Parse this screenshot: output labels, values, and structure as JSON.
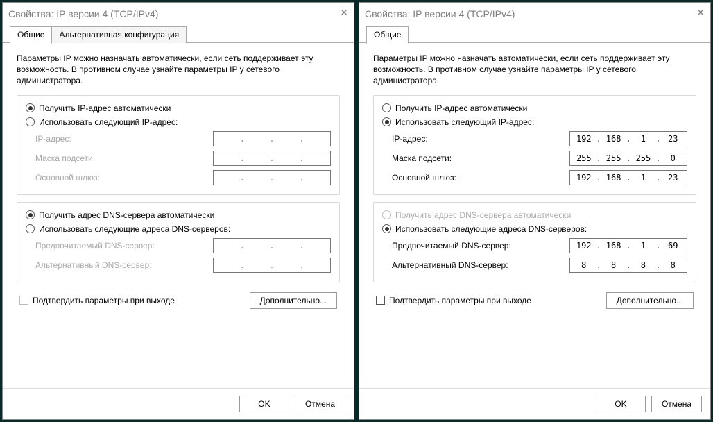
{
  "left": {
    "title": "Свойства: IP версии 4 (TCP/IPv4)",
    "tabs": {
      "general": "Общие",
      "alt": "Альтернативная конфигурация"
    },
    "intro": "Параметры IP можно назначать автоматически, если сеть поддерживает эту возможность. В противном случае узнайте параметры IP у сетевого администратора.",
    "ip_group": {
      "auto": "Получить IP-адрес автоматически",
      "manual": "Использовать следующий IP-адрес:",
      "selected": "auto",
      "fields": {
        "ip_label": "IP-адрес:",
        "mask_label": "Маска подсети:",
        "gw_label": "Основной шлюз:",
        "ip": [
          "",
          "",
          "",
          ""
        ],
        "mask": [
          "",
          "",
          "",
          ""
        ],
        "gw": [
          "",
          "",
          "",
          ""
        ]
      }
    },
    "dns_group": {
      "auto": "Получить адрес DNS-сервера автоматически",
      "manual": "Использовать следующие адреса DNS-серверов:",
      "selected": "auto",
      "fields": {
        "pref_label": "Предпочитаемый DNS-сервер:",
        "alt_label": "Альтернативный DNS-сервер:",
        "pref": [
          "",
          "",
          "",
          ""
        ],
        "alt": [
          "",
          "",
          "",
          ""
        ]
      }
    },
    "validate": "Подтвердить параметры при выходе",
    "advanced": "Дополнительно...",
    "ok": "OK",
    "cancel": "Отмена"
  },
  "right": {
    "title": "Свойства: IP версии 4 (TCP/IPv4)",
    "tabs": {
      "general": "Общие"
    },
    "intro": "Параметры IP можно назначать автоматически, если сеть поддерживает эту возможность. В противном случае узнайте параметры IP у сетевого администратора.",
    "ip_group": {
      "auto": "Получить IP-адрес автоматически",
      "manual": "Использовать следующий IP-адрес:",
      "selected": "manual",
      "fields": {
        "ip_label": "IP-адрес:",
        "mask_label": "Маска подсети:",
        "gw_label": "Основной шлюз:",
        "ip": [
          "192",
          "168",
          "1",
          "23"
        ],
        "mask": [
          "255",
          "255",
          "255",
          "0"
        ],
        "gw": [
          "192",
          "168",
          "1",
          "23"
        ]
      }
    },
    "dns_group": {
      "auto": "Получить адрес DNS-сервера автоматически",
      "manual": "Использовать следующие адреса DNS-серверов:",
      "selected": "manual",
      "fields": {
        "pref_label": "Предпочитаемый DNS-сервер:",
        "alt_label": "Альтернативный DNS-сервер:",
        "pref": [
          "192",
          "168",
          "1",
          "69"
        ],
        "alt": [
          "8",
          "8",
          "8",
          "8"
        ]
      }
    },
    "validate": "Подтвердить параметры при выходе",
    "advanced": "Дополнительно...",
    "ok": "OK",
    "cancel": "Отмена"
  }
}
